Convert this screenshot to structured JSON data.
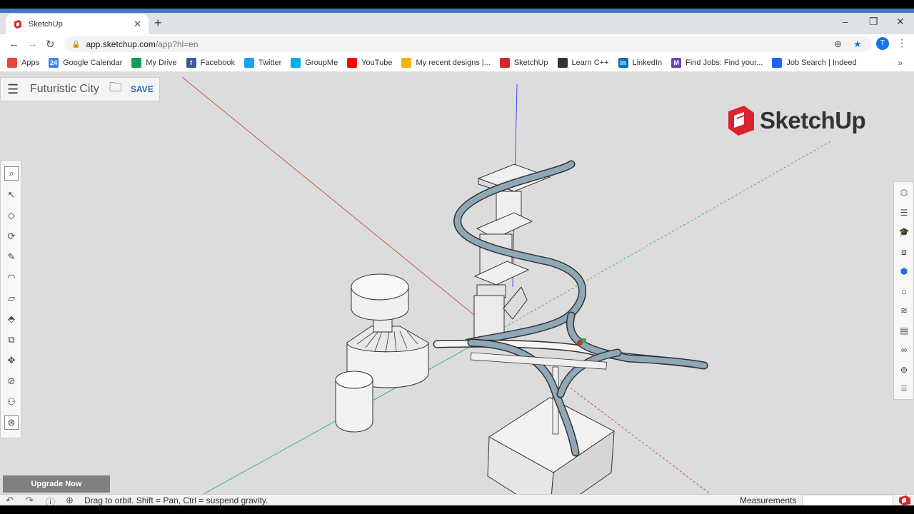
{
  "browser": {
    "tab_title": "SketchUp",
    "url_host": "app.sketchup.com",
    "url_path": "/app?hl=en",
    "avatar_letter": "T",
    "bookmarks": [
      {
        "label": "Apps",
        "icon": "apps-grid-icon",
        "color": "#e8453c"
      },
      {
        "label": "Google Calendar",
        "icon": "calendar-icon",
        "color": "#4285f4",
        "glyph": "24"
      },
      {
        "label": "My Drive",
        "icon": "drive-icon",
        "color": "#0f9d58"
      },
      {
        "label": "Facebook",
        "icon": "facebook-icon",
        "color": "#3b5998",
        "glyph": "f"
      },
      {
        "label": "Twitter",
        "icon": "twitter-icon",
        "color": "#1da1f2"
      },
      {
        "label": "GroupMe",
        "icon": "groupme-icon",
        "color": "#00aff0"
      },
      {
        "label": "YouTube",
        "icon": "youtube-icon",
        "color": "#ff0000"
      },
      {
        "label": "My recent designs |...",
        "icon": "designs-icon",
        "color": "#f4b400"
      },
      {
        "label": "SketchUp",
        "icon": "sketchup-icon",
        "color": "#d9232d"
      },
      {
        "label": "Learn C++",
        "icon": "cpp-icon",
        "color": "#333333"
      },
      {
        "label": "LinkedIn",
        "icon": "linkedin-icon",
        "color": "#0077b5",
        "glyph": "in"
      },
      {
        "label": "Find Jobs: Find your...",
        "icon": "monster-icon",
        "color": "#6e46ae",
        "glyph": "M"
      },
      {
        "label": "Job Search | Indeed",
        "icon": "indeed-icon",
        "color": "#2164f3"
      }
    ]
  },
  "app": {
    "document_title": "Futuristic City",
    "save_label": "SAVE",
    "logo_text": "SketchUp",
    "upgrade_label": "Upgrade Now",
    "status_text": "Drag to orbit. Shift = Pan, Ctrl = suspend gravity.",
    "measurements_label": "Measurements",
    "measurements_value": ""
  },
  "colors": {
    "accent": "#2b6cb0",
    "brand_red": "#d9232d",
    "axis_red": "#c0392b",
    "axis_green": "#27ae60",
    "axis_blue": "#2c3ee0",
    "selection_blue": "#8fa8b8"
  }
}
